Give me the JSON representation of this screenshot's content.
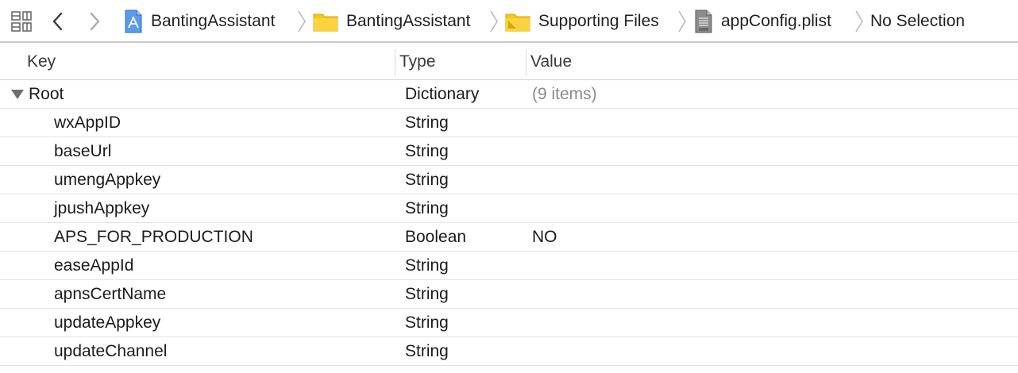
{
  "jumpbar": {
    "crumbs": [
      {
        "label": "BantingAssistant",
        "icon": "xcode-project-icon"
      },
      {
        "label": "BantingAssistant",
        "icon": "folder-icon"
      },
      {
        "label": "Supporting Files",
        "icon": "folder-icon"
      },
      {
        "label": "appConfig.plist",
        "icon": "plist-file-icon"
      },
      {
        "label": "No Selection",
        "icon": ""
      }
    ]
  },
  "table": {
    "headers": {
      "key": "Key",
      "type": "Type",
      "value": "Value"
    },
    "root": {
      "key": "Root",
      "type": "Dictionary",
      "value": "(9 items)"
    },
    "rows": [
      {
        "key": "wxAppID",
        "type": "String",
        "value": ""
      },
      {
        "key": "baseUrl",
        "type": "String",
        "value": ""
      },
      {
        "key": "umengAppkey",
        "type": "String",
        "value": ""
      },
      {
        "key": "jpushAppkey",
        "type": "String",
        "value": ""
      },
      {
        "key": "APS_FOR_PRODUCTION",
        "type": "Boolean",
        "value": "NO"
      },
      {
        "key": "easeAppId",
        "type": "String",
        "value": ""
      },
      {
        "key": "apnsCertName",
        "type": "String",
        "value": ""
      },
      {
        "key": "updateAppkey",
        "type": "String",
        "value": ""
      },
      {
        "key": "updateChannel",
        "type": "String",
        "value": ""
      }
    ]
  },
  "colors": {
    "folder": "#f5c518",
    "project": "#4a90e2",
    "separator": "#c9c9c9"
  }
}
